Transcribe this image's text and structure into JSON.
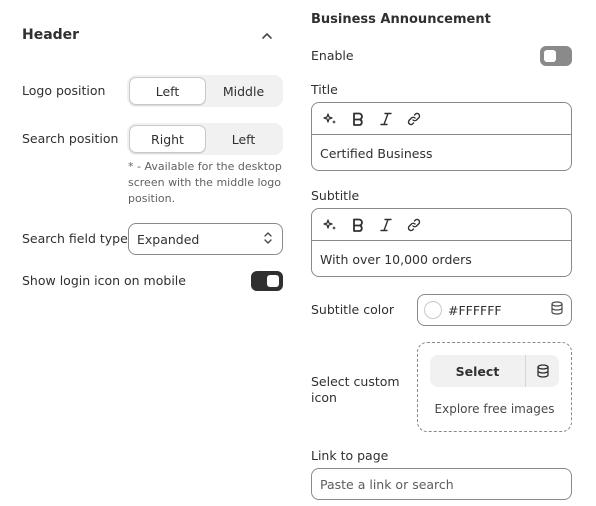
{
  "header": {
    "title": "Header",
    "logo_position": {
      "label": "Logo position",
      "options": [
        "Left",
        "Middle"
      ],
      "selected": "Left"
    },
    "search_position": {
      "label": "Search position",
      "options": [
        "Right",
        "Left"
      ],
      "selected": "Right",
      "note": "* - Available for the desktop screen with the middle logo position."
    },
    "search_field_type": {
      "label": "Search field type",
      "value": "Expanded"
    },
    "show_login_icon_mobile": {
      "label": "Show login icon on mobile",
      "on": true
    }
  },
  "announcement": {
    "title": "Business Announcement",
    "enable": {
      "label": "Enable",
      "on": false
    },
    "title_field": {
      "label": "Title",
      "value": "Certified Business"
    },
    "subtitle_field": {
      "label": "Subtitle",
      "value": "With over 10,000 orders"
    },
    "subtitle_color": {
      "label": "Subtitle color",
      "value": "#FFFFFF"
    },
    "custom_icon": {
      "label": "Select custom icon",
      "select_label": "Select",
      "explore_label": "Explore free images"
    },
    "link_to_page": {
      "label": "Link to page",
      "placeholder": "Paste a link or search"
    }
  },
  "icons": [
    "chevron-up-icon",
    "sparkle-icon",
    "bold-icon",
    "italic-icon",
    "link-icon",
    "select-arrows-icon",
    "database-icon"
  ],
  "colors": {
    "toggle_on": "#303030",
    "toggle_off": "#8a8a8a",
    "border": "#8a8a8a",
    "segment_bg": "#f1f1f1"
  }
}
